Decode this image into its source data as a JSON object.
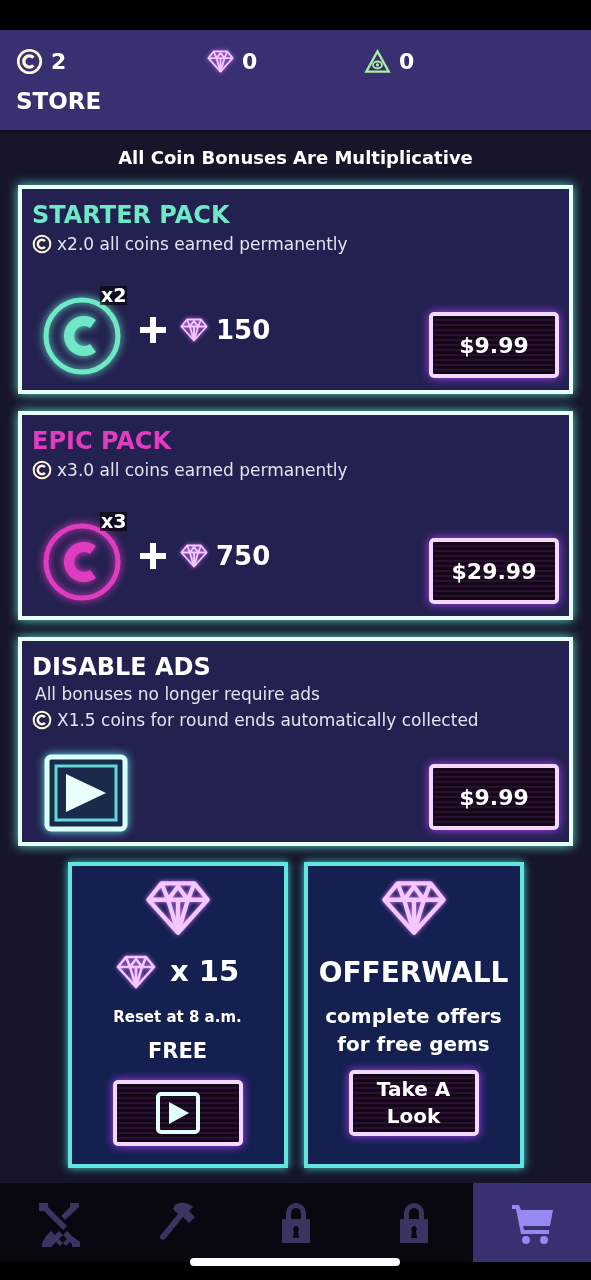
{
  "currencies": [
    {
      "kind": "coin",
      "value": "2"
    },
    {
      "kind": "gem",
      "value": "0"
    },
    {
      "kind": "token",
      "value": "0"
    }
  ],
  "title": "STORE",
  "notice": "All Coin Bonuses Are Multiplicative",
  "packs": [
    {
      "kind": "multiplier",
      "title": "STARTER PACK",
      "color": "#6ee8c6",
      "lines": [
        "x2.0 all coins earned permanently"
      ],
      "badge": "x2",
      "gems": "150",
      "price": "$9.99"
    },
    {
      "kind": "multiplier",
      "title": "EPIC PACK",
      "color": "#e03cc0",
      "lines": [
        "x3.0 all coins earned permanently"
      ],
      "badge": "x3",
      "gems": "750",
      "price": "$29.99"
    },
    {
      "kind": "ads",
      "title": "DISABLE ADS",
      "color": "#ffffff",
      "lines": [
        "All bonuses no longer require ads",
        "X1.5 coins for round ends automatically collected"
      ],
      "price": "$9.99"
    }
  ],
  "offers": [
    {
      "kind": "free_gems",
      "amount": "x 15",
      "note": "Reset at 8 a.m.",
      "label": "FREE"
    },
    {
      "kind": "offerwall",
      "heading": "OFFERWALL",
      "note": "complete offers for free gems",
      "button": "Take A Look"
    }
  ],
  "tabs": [
    {
      "kind": "swords",
      "selected": false
    },
    {
      "kind": "hammer",
      "selected": false
    },
    {
      "kind": "lock",
      "selected": false
    },
    {
      "kind": "lock",
      "selected": false
    },
    {
      "kind": "cart",
      "selected": true
    }
  ]
}
